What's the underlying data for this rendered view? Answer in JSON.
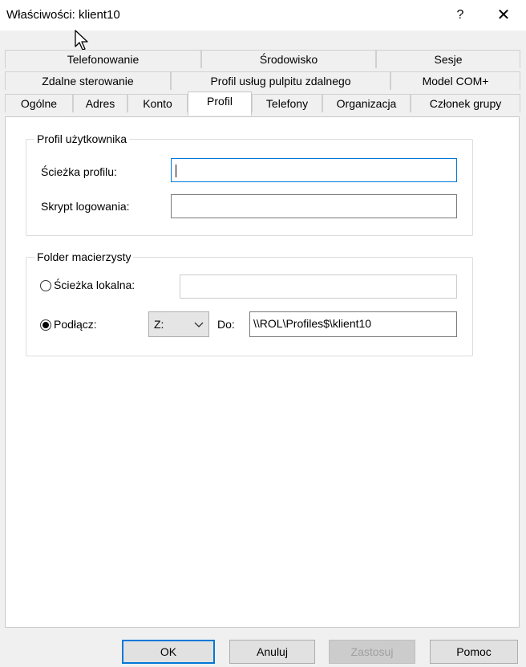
{
  "window": {
    "title": "Właściwości: klient10",
    "help": "?",
    "close": "✕"
  },
  "tabs": {
    "row1": [
      "Telefonowanie",
      "Środowisko",
      "Sesje"
    ],
    "row2": [
      "Zdalne sterowanie",
      "Profil usług pulpitu zdalnego",
      "Model COM+"
    ],
    "row3": [
      "Ogólne",
      "Adres",
      "Konto",
      "Profil",
      "Telefony",
      "Organizacja",
      "Członek grupy"
    ],
    "active": "Profil"
  },
  "user_profile": {
    "legend": "Profil użytkownika",
    "profile_path_label": "Ścieżka profilu:",
    "profile_path_value": "",
    "logon_script_label": "Skrypt logowania:",
    "logon_script_value": ""
  },
  "home_folder": {
    "legend": "Folder macierzysty",
    "local_path_label": "Ścieżka lokalna:",
    "local_path_value": "",
    "local_path_selected": false,
    "connect_label": "Podłącz:",
    "connect_selected": true,
    "drive_value": "Z:",
    "to_label": "Do:",
    "to_value": "\\\\ROL\\Profiles$\\klient10"
  },
  "buttons": {
    "ok": "OK",
    "cancel": "Anuluj",
    "apply": "Zastosuj",
    "help": "Pomoc"
  },
  "colors": {
    "focus_border": "#0078d7",
    "panel_bg": "#ffffff",
    "dialog_bg": "#f0f0f0"
  }
}
